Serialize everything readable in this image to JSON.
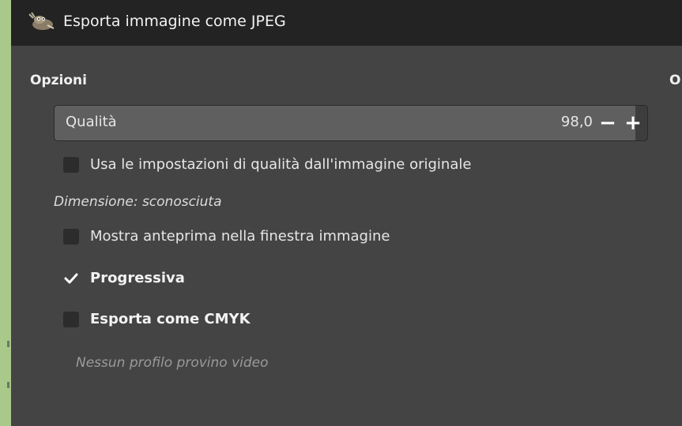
{
  "window": {
    "title": "Esporta immagine come JPEG"
  },
  "options": {
    "heading": "Opzioni",
    "right_heading_partial": "O"
  },
  "quality": {
    "label": "Qualità",
    "value": "98,0",
    "level_percent": 98,
    "decrement_symbol": "−",
    "increment_symbol": "+"
  },
  "checkboxes": {
    "use_original_quality": {
      "label": "Usa le impostazioni di qualità dall'immagine originale",
      "checked": false
    },
    "show_preview": {
      "label": "Mostra anteprima nella finestra immagine",
      "checked": false
    },
    "progressive": {
      "label": "Progressiva",
      "checked": true
    },
    "export_cmyk": {
      "label": "Esporta come CMYK",
      "checked": false
    }
  },
  "info": {
    "size": "Dimensione: sconosciuta",
    "softproof_profile": "Nessun profilo provino video"
  },
  "colors": {
    "titlebar": "#232323",
    "dialog_bg": "#444444",
    "slider_fill": "#5f5f5f",
    "outer_bg": "#a8c98a"
  },
  "icons": {
    "app": "gimp-wilber-icon",
    "checkmark": "checkmark-icon"
  }
}
